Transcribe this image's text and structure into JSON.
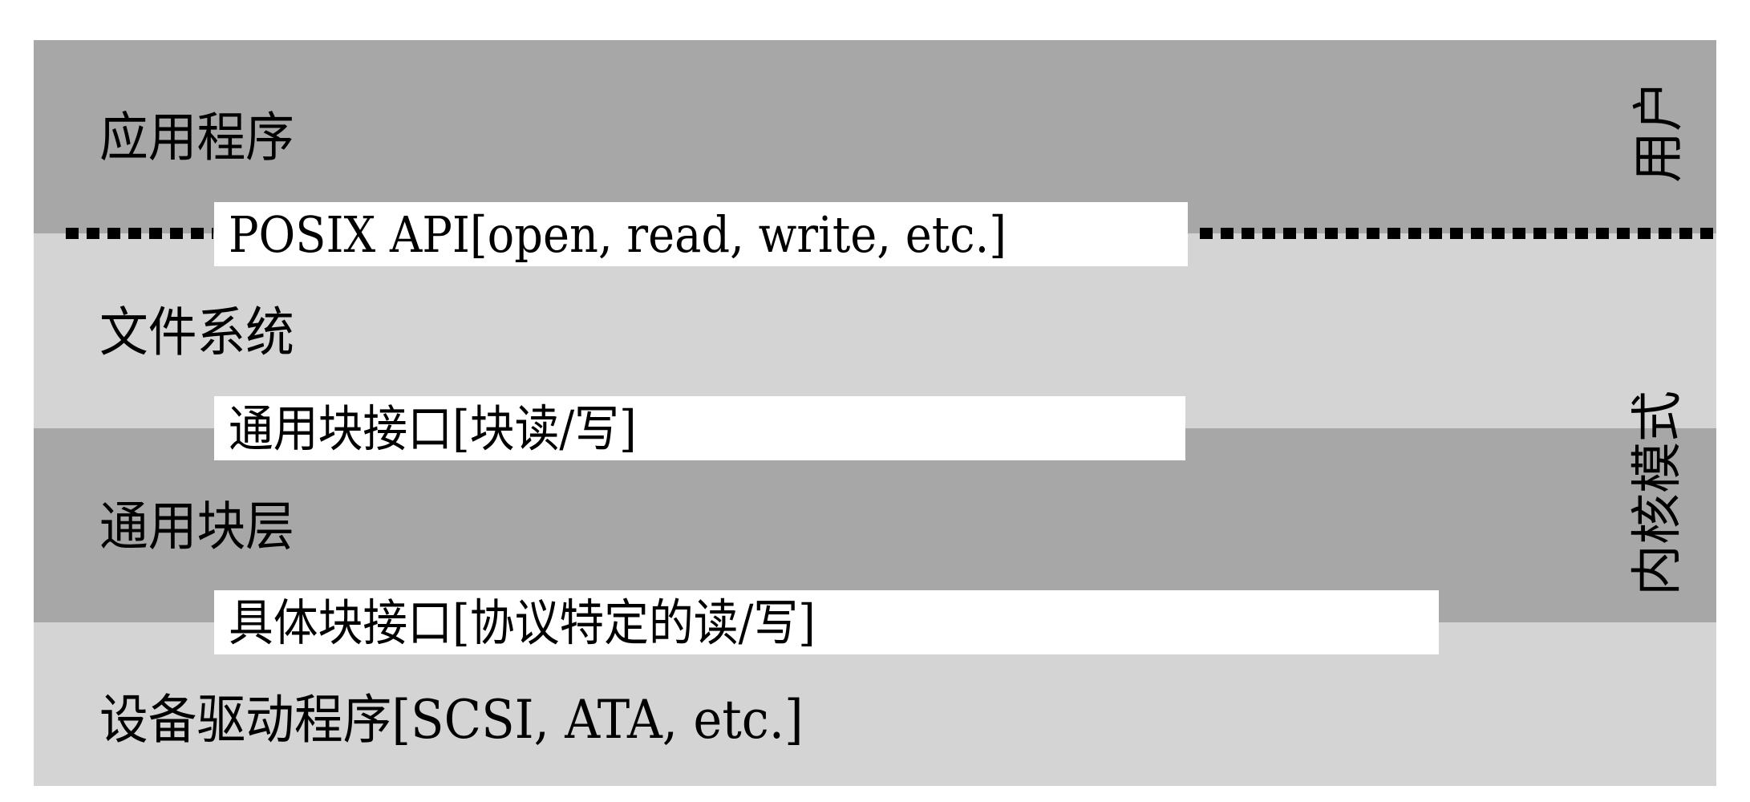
{
  "layers": {
    "application": "应用程序",
    "file_system": "文件系统",
    "generic_block_layer": "通用块层",
    "device_driver": "设备驱动程序[SCSI, ATA, etc.]"
  },
  "interfaces": {
    "posix_api": "POSIX API[open, read, write, etc.]",
    "generic_block_interface": "通用块接口[块读/写]",
    "specific_block_interface": "具体块接口[协议特定的读/写]"
  },
  "modes": {
    "user": "用户",
    "kernel": "内核模式"
  },
  "colors": {
    "dark_band": "#a7a7a7",
    "light_band": "#d4d4d4",
    "interface_box": "#ffffff",
    "text": "#000000"
  }
}
